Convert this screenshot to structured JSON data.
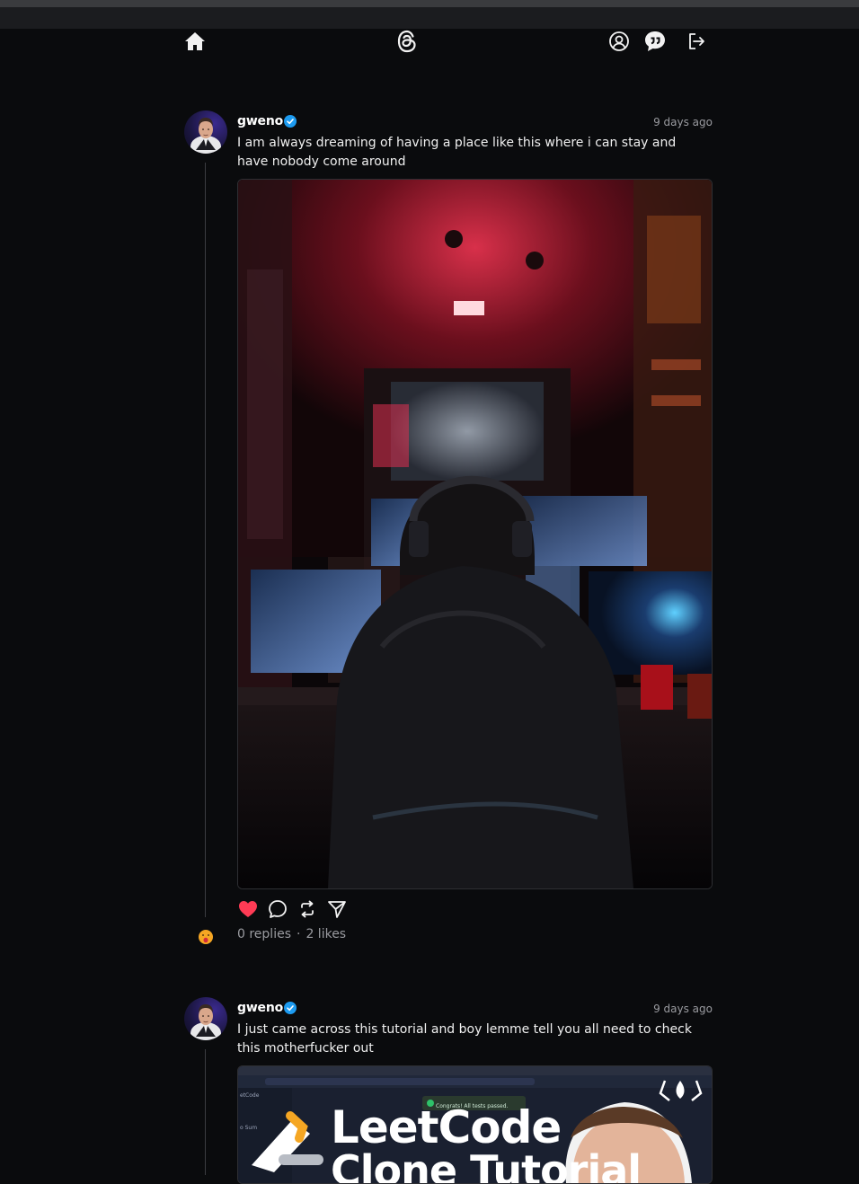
{
  "nav": {
    "icons": [
      "home-icon",
      "threads-logo-icon",
      "user-profile-icon",
      "chat-icon",
      "logout-icon"
    ]
  },
  "posts": [
    {
      "username": "gweno",
      "verified": true,
      "time": "9 days ago",
      "text": "I am always dreaming of having a place like this where i can stay and have nobody come around",
      "image_description": "person with headphones at gaming setup in neon red room",
      "liked": true,
      "replies": "0 replies",
      "likes": "2 likes"
    },
    {
      "username": "gweno",
      "verified": true,
      "time": "9 days ago",
      "text": "I just came across this tutorial and boy lemme tell you all need to check this motherfucker out",
      "thumbnail": {
        "title_line1": "LeetCode",
        "title_line2": "Clone Tutorial",
        "toast": "Congrats! All tests passed.",
        "side_labels": [
          "etCode",
          "o Sum"
        ]
      }
    }
  ],
  "colors": {
    "background": "#0a0b0d",
    "like": "#ff3b55",
    "verified": "#1d9bf0",
    "muted": "#9a9ba0"
  }
}
